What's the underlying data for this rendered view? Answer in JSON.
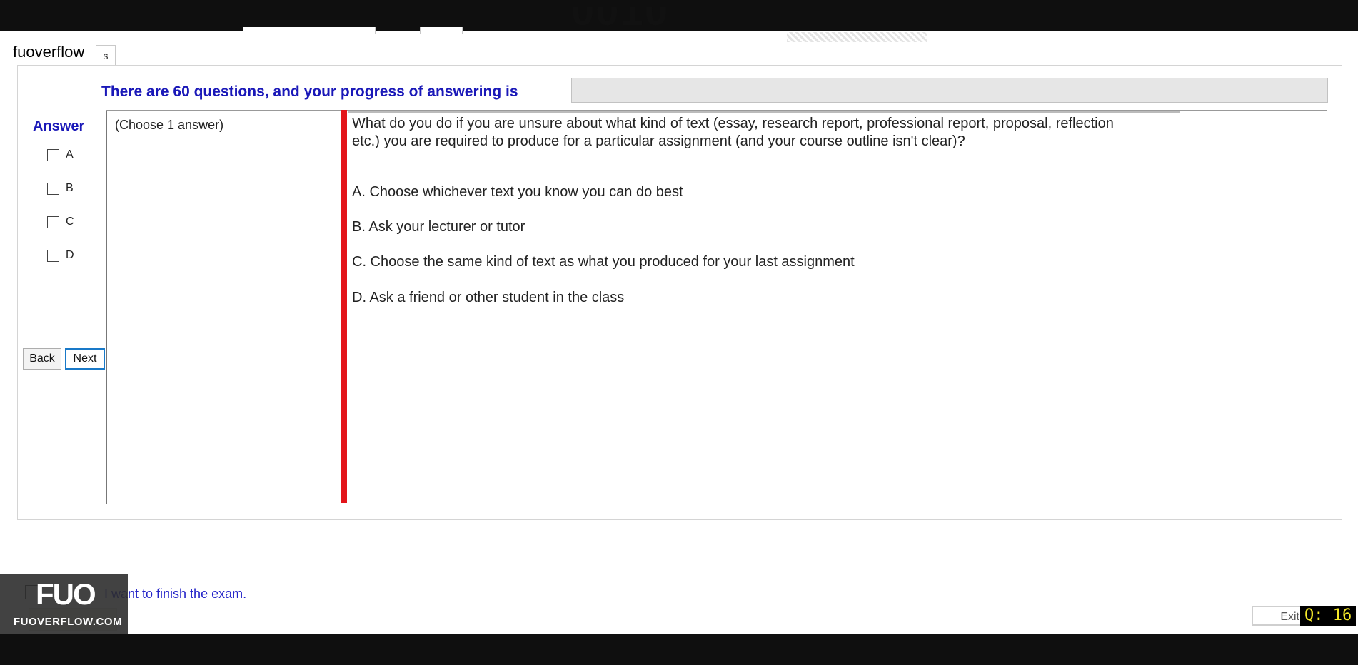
{
  "header": {
    "top_text": "0010 1"
  },
  "watermark": {
    "label": "fuoverflow",
    "logo_big": "FUO",
    "logo_site": "FUOVERFLOW.COM"
  },
  "tab": {
    "label": "s"
  },
  "progress": {
    "label": "There are 60 questions, and your progress of answering is",
    "fraction": 0
  },
  "answer_panel": {
    "title": "Answer",
    "options": [
      "A",
      "B",
      "C",
      "D"
    ],
    "back_label": "Back",
    "next_label": "Next"
  },
  "instruction": "(Choose 1 answer)",
  "question": {
    "text": "What do you do if you are unsure about what kind of text (essay, research report, professional report, proposal, reflection etc.) you are required to produce for a particular assignment (and your course outline isn't clear)?",
    "options": [
      "A.  Choose whichever text you know you can do best",
      "B.  Ask your lecturer or tutor",
      "C.  Choose the same kind of text as what you produced for your last assignment",
      "D.  Ask a friend or other student in the class"
    ]
  },
  "footer": {
    "finish_text": "I want to finish the exam.",
    "exit_label": "Exit",
    "counter": "Q: 16"
  }
}
